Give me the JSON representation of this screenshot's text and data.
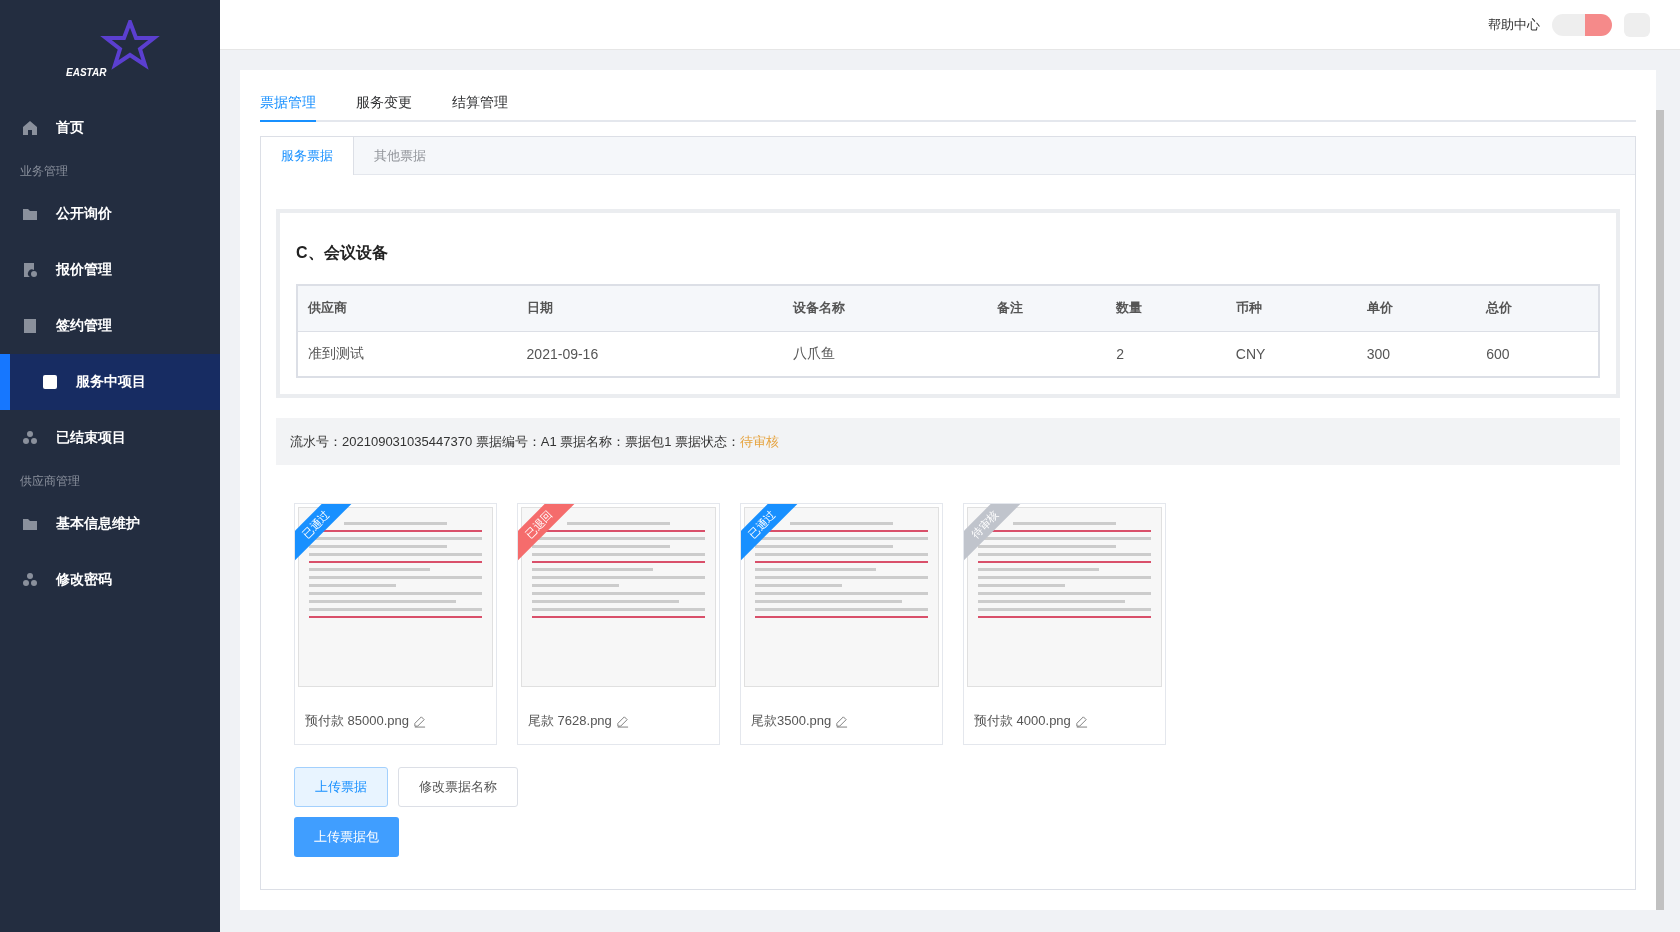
{
  "logo": {
    "text": "EASTAR"
  },
  "sidebar": {
    "items": [
      {
        "kind": "item",
        "label": "首页",
        "selected": false
      },
      {
        "kind": "group",
        "label": "业务管理"
      },
      {
        "kind": "item",
        "label": "公开询价",
        "selected": false
      },
      {
        "kind": "item",
        "label": "报价管理",
        "selected": false
      },
      {
        "kind": "item",
        "label": "签约管理",
        "selected": false
      },
      {
        "kind": "item",
        "label": "服务中项目",
        "selected": true
      },
      {
        "kind": "item",
        "label": "已结束项目",
        "selected": false
      },
      {
        "kind": "group",
        "label": "供应商管理"
      },
      {
        "kind": "item",
        "label": "基本信息维护",
        "selected": false
      },
      {
        "kind": "item",
        "label": "修改密码",
        "selected": false
      }
    ]
  },
  "header": {
    "help": "帮助中心"
  },
  "tabs": [
    {
      "label": "票据管理",
      "selected": true
    },
    {
      "label": "服务变更",
      "selected": false
    },
    {
      "label": "结算管理",
      "selected": false
    }
  ],
  "subtabs": [
    {
      "label": "服务票据",
      "selected": true
    },
    {
      "label": "其他票据",
      "selected": false
    }
  ],
  "section": {
    "title": "C、会议设备",
    "columns": [
      "供应商",
      "日期",
      "设备名称",
      "备注",
      "数量",
      "币种",
      "单价",
      "总价"
    ],
    "rows": [
      [
        "准到测试",
        "2021-09-16",
        "八爪鱼",
        "",
        "2",
        "CNY",
        "300",
        "600"
      ]
    ]
  },
  "info": {
    "text": "流水号：202109031035447370 票据编号：A1 票据名称：票据包1 票据状态：",
    "status": "待审核"
  },
  "files": [
    {
      "name": "预付款 85000.png",
      "ribbon": "已通过",
      "color": "#1890ff"
    },
    {
      "name": "尾款 7628.png",
      "ribbon": "已退回",
      "color": "#f56c6c"
    },
    {
      "name": "尾款3500.png",
      "ribbon": "已通过",
      "color": "#1890ff"
    },
    {
      "name": "预付款 4000.png",
      "ribbon": "待审核",
      "color": "#c0c4cc"
    }
  ],
  "buttons": [
    {
      "kind": "light",
      "label": "上传票据"
    },
    {
      "kind": "plain",
      "label": "修改票据名称"
    }
  ],
  "upload_button": {
    "label": "上传票据包"
  }
}
